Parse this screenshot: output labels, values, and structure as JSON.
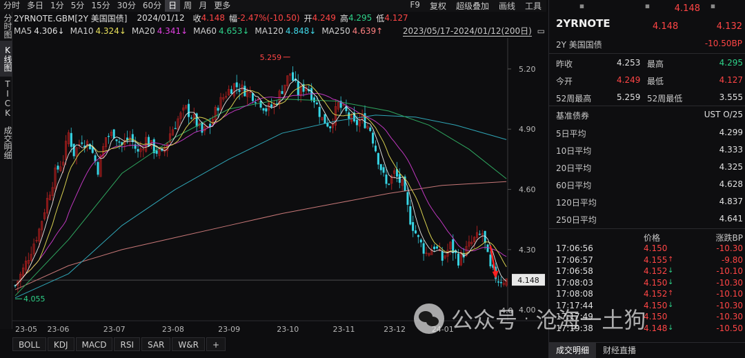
{
  "toolbar": {
    "periods": [
      "分时",
      "多日",
      "1分",
      "5分",
      "15分",
      "30分",
      "60分",
      "日",
      "周",
      "月",
      "更多"
    ],
    "active_period": "日",
    "right": [
      "F9",
      "复权",
      "超级叠加",
      "画线",
      "工具"
    ]
  },
  "vtabs": [
    "分时图",
    "K线图",
    "TICK",
    "成交明细"
  ],
  "info": {
    "symbol": "2YRNOTE.GBM[2Y 美国国债]",
    "date": "2024/01/12",
    "close_label": "收",
    "close": "4.148",
    "amp_label": "幅",
    "amp": "-2.47%(-10.50)",
    "open_label": "开",
    "open": "4.249",
    "high_label": "高",
    "high": "4.295",
    "low_label": "低",
    "low": "4.127"
  },
  "ma": [
    {
      "label": "MA5",
      "value": "4.306↓",
      "color": "#e0e0e0"
    },
    {
      "label": "MA10",
      "value": "4.324↓",
      "color": "#e8e05a"
    },
    {
      "label": "MA20",
      "value": "4.341↓",
      "color": "#e040e0"
    },
    {
      "label": "MA60",
      "value": "4.653↓",
      "color": "#2ed38a"
    },
    {
      "label": "MA120",
      "value": "4.848↓",
      "color": "#40d8e8"
    },
    {
      "label": "MA250",
      "value": "4.639↑",
      "color": "#ff8080"
    }
  ],
  "range_label": "2023/05/17-2024/01/12(200日)",
  "chart_data": {
    "type": "candlestick",
    "y_ticks": [
      "5.20",
      "4.90",
      "4.60",
      "4.30",
      "4.00"
    ],
    "y_tick_values": [
      5.2,
      4.9,
      4.6,
      4.3,
      4.0
    ],
    "ylim": [
      3.98,
      5.32
    ],
    "x_ticks": [
      "23-05",
      "23-06",
      "23-07",
      "23-08",
      "23-09",
      "23-10",
      "23-11",
      "23-12",
      "24-01"
    ],
    "x_tick_index": [
      0,
      12,
      33,
      55,
      76,
      98,
      119,
      138,
      156
    ],
    "max_label": "5.259",
    "max_value": 5.259,
    "min_label": "4.055",
    "min_value": 4.055,
    "last_label": "4.148",
    "last_value": 4.148,
    "overlay_labels": {
      "a": "4.0",
      "b": "4.0",
      "c": "24-01"
    },
    "close_path": [
      [
        0,
        4.12
      ],
      [
        3,
        4.2
      ],
      [
        6,
        4.3
      ],
      [
        9,
        4.4
      ],
      [
        12,
        4.55
      ],
      [
        15,
        4.68
      ],
      [
        18,
        4.75
      ],
      [
        20,
        4.88
      ],
      [
        22,
        4.78
      ],
      [
        25,
        4.85
      ],
      [
        28,
        4.82
      ],
      [
        31,
        4.7
      ],
      [
        34,
        4.86
      ],
      [
        37,
        4.88
      ],
      [
        40,
        4.82
      ],
      [
        43,
        4.86
      ],
      [
        46,
        4.78
      ],
      [
        49,
        4.85
      ],
      [
        52,
        4.8
      ],
      [
        55,
        4.77
      ],
      [
        58,
        4.88
      ],
      [
        61,
        4.95
      ],
      [
        64,
        5.0
      ],
      [
        67,
        4.95
      ],
      [
        70,
        4.88
      ],
      [
        73,
        4.92
      ],
      [
        76,
        5.02
      ],
      [
        79,
        5.08
      ],
      [
        82,
        5.12
      ],
      [
        85,
        5.1
      ],
      [
        88,
        5.08
      ],
      [
        91,
        5.05
      ],
      [
        94,
        5.0
      ],
      [
        97,
        5.02
      ],
      [
        100,
        5.1
      ],
      [
        103,
        5.18
      ],
      [
        106,
        5.08
      ],
      [
        109,
        5.12
      ],
      [
        112,
        5.05
      ],
      [
        115,
        4.95
      ],
      [
        118,
        4.92
      ],
      [
        121,
        5.02
      ],
      [
        124,
        4.98
      ],
      [
        127,
        4.92
      ],
      [
        130,
        4.95
      ],
      [
        133,
        4.9
      ],
      [
        136,
        4.75
      ],
      [
        139,
        4.62
      ],
      [
        142,
        4.68
      ],
      [
        145,
        4.62
      ],
      [
        148,
        4.45
      ],
      [
        151,
        4.35
      ],
      [
        154,
        4.28
      ],
      [
        157,
        4.32
      ],
      [
        160,
        4.25
      ],
      [
        163,
        4.32
      ],
      [
        166,
        4.25
      ],
      [
        169,
        4.3
      ],
      [
        172,
        4.35
      ],
      [
        175,
        4.38
      ],
      [
        178,
        4.2
      ],
      [
        181,
        4.15
      ],
      [
        184,
        4.148
      ]
    ],
    "ma250_path": [
      [
        0,
        4.1
      ],
      [
        20,
        4.22
      ],
      [
        40,
        4.3
      ],
      [
        60,
        4.36
      ],
      [
        80,
        4.42
      ],
      [
        100,
        4.48
      ],
      [
        120,
        4.53
      ],
      [
        140,
        4.58
      ],
      [
        160,
        4.62
      ],
      [
        184,
        4.639
      ]
    ],
    "ma120_path": [
      [
        0,
        4.06
      ],
      [
        20,
        4.18
      ],
      [
        40,
        4.42
      ],
      [
        60,
        4.6
      ],
      [
        80,
        4.75
      ],
      [
        100,
        4.88
      ],
      [
        120,
        4.94
      ],
      [
        135,
        4.97
      ],
      [
        150,
        4.96
      ],
      [
        165,
        4.92
      ],
      [
        184,
        4.848
      ]
    ],
    "ma60_path": [
      [
        0,
        4.07
      ],
      [
        20,
        4.35
      ],
      [
        40,
        4.68
      ],
      [
        60,
        4.86
      ],
      [
        80,
        5.0
      ],
      [
        100,
        5.05
      ],
      [
        120,
        5.04
      ],
      [
        140,
        4.99
      ],
      [
        155,
        4.92
      ],
      [
        170,
        4.8
      ],
      [
        184,
        4.653
      ]
    ]
  },
  "indicator_tabs": [
    "BOLL",
    "KDJ",
    "MACD",
    "RSI",
    "SAR",
    "W&R",
    "+"
  ],
  "right_panel": {
    "price_top": "4.148",
    "symbol": "2YRNOTE",
    "price": "4.148",
    "change": "4.132",
    "name": "2Y 美国国债",
    "change_bp": "-10.50BP",
    "quote_rows": [
      {
        "l1": "昨收",
        "v1": "4.253",
        "l2": "最高",
        "v2": "4.295",
        "c1": "#e0e0e0",
        "c2": "#2ed38a"
      },
      {
        "l1": "今开",
        "v1": "4.249",
        "l2": "最低",
        "v2": "4.127",
        "c1": "#ff4545",
        "c2": "#ff4545"
      },
      {
        "l1": "52周最高",
        "v1": "5.259",
        "l2": "52周最低",
        "v2": "3.555",
        "c1": "#e0e0e0",
        "c2": "#e0e0e0"
      }
    ],
    "benchmark_label": "基准债券",
    "benchmark_value": "UST O/25",
    "averages": [
      {
        "label": "5日平均",
        "value": "4.299"
      },
      {
        "label": "10日平均",
        "value": "4.333"
      },
      {
        "label": "20日平均",
        "value": "4.325"
      },
      {
        "label": "60日平均",
        "value": "4.628"
      },
      {
        "label": "120日平均",
        "value": "4.837"
      },
      {
        "label": "250日平均",
        "value": "4.641"
      }
    ],
    "trade_header": {
      "price": "价格",
      "bp": "涨跌BP"
    },
    "trades": [
      {
        "time": "17:06:56",
        "price": "4.150",
        "arrow": "",
        "bp": "-10.30"
      },
      {
        "time": "17:06:57",
        "price": "4.155",
        "arrow": "↑",
        "bp": "-9.80"
      },
      {
        "time": "17:06:58",
        "price": "4.152",
        "arrow": "↓",
        "bp": "-10.10"
      },
      {
        "time": "17:08:03",
        "price": "4.150",
        "arrow": "↓",
        "bp": "-10.30"
      },
      {
        "time": "17:08:08",
        "price": "4.152",
        "arrow": "↑",
        "bp": "-10.10"
      },
      {
        "time": "17:17:44",
        "price": "4.150",
        "arrow": "↓",
        "bp": "-10.30"
      },
      {
        "time": "17:17:49",
        "price": "4.150",
        "arrow": "",
        "bp": "-10.30"
      },
      {
        "time": "17:19:38",
        "price": "4.148",
        "arrow": "↓",
        "bp": "-10.50"
      }
    ],
    "tabs": [
      "成交明细",
      "财经直播"
    ]
  },
  "watermark": {
    "brand": "公众号",
    "sep": "·",
    "author": "沧海一土狗"
  }
}
